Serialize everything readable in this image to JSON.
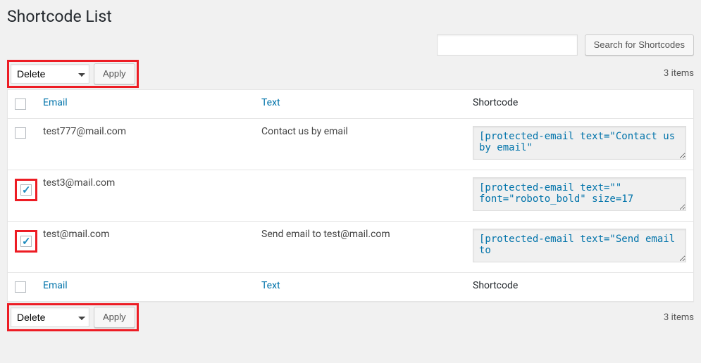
{
  "page": {
    "title": "Shortcode List"
  },
  "search": {
    "value": "",
    "button": "Search for Shortcodes"
  },
  "bulk": {
    "selected": "Delete",
    "apply": "Apply"
  },
  "items_count": "3 items",
  "columns": {
    "email": "Email",
    "text": "Text",
    "shortcode": "Shortcode"
  },
  "rows": [
    {
      "checked": false,
      "highlight": false,
      "email": "test777@mail.com",
      "text": "Contact us by email",
      "shortcode": "[protected-email text=\"Contact us by email\""
    },
    {
      "checked": true,
      "highlight": true,
      "email": "test3@mail.com",
      "text": "",
      "shortcode": "[protected-email text=\"\" font=\"roboto_bold\" size=17"
    },
    {
      "checked": true,
      "highlight": true,
      "email": "test@mail.com",
      "text": "Send email to test@mail.com",
      "shortcode": "[protected-email text=\"Send email to"
    }
  ]
}
